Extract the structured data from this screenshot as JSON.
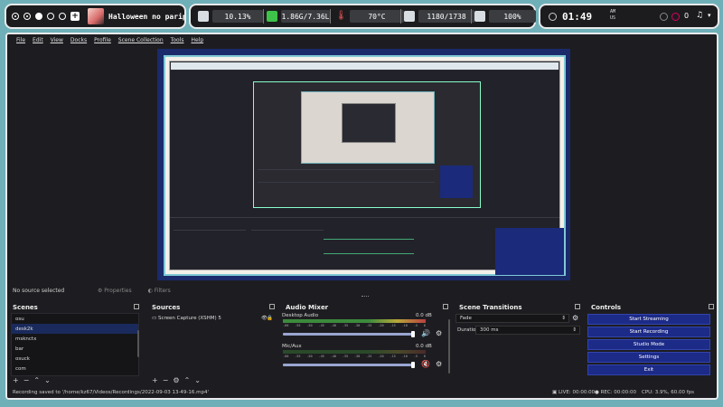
{
  "waybar": {
    "window_title": "Halloween no paripi",
    "cpu": "10.13%",
    "ram": "1.86G/7.36L",
    "temp": "70°C",
    "disk": "1180/1738",
    "battery": "100%",
    "time_hm": "01:49",
    "time_ampm_top": "AM",
    "time_ampm_bottom": "US",
    "notif_count": "0"
  },
  "menu": [
    "File",
    "Edit",
    "View",
    "Docks",
    "Profile",
    "Scene Collection",
    "Tools",
    "Help"
  ],
  "preview_toolbar": {
    "no_source": "No source selected",
    "properties": "Properties",
    "filters": "Filters"
  },
  "scenes": {
    "title": "Scenes",
    "items": [
      "osu",
      "desk2k",
      "msknctx",
      "bar",
      "osuck",
      "com"
    ],
    "selected_index": 1
  },
  "sources": {
    "title": "Sources",
    "items": [
      "Screen Capture (XSHM) 5"
    ]
  },
  "mixer": {
    "title": "Audio Mixer",
    "channels": [
      {
        "name": "Desktop Audio",
        "db": "0.0 dB"
      },
      {
        "name": "Mic/Aux",
        "db": "0.0 dB"
      }
    ],
    "ticks": [
      "-60",
      "-55",
      "-50",
      "-45",
      "-40",
      "-35",
      "-30",
      "-25",
      "-20",
      "-15",
      "-10",
      "-5",
      "0"
    ]
  },
  "transitions": {
    "title": "Scene Transitions",
    "selected": "Fade",
    "duration_label": "Duration",
    "duration_value": "300 ms"
  },
  "controls": {
    "title": "Controls",
    "buttons": [
      "Start Streaming",
      "Start Recording",
      "Studio Mode",
      "Settings",
      "Exit"
    ]
  },
  "status": {
    "left": "Recording saved to '/home/kz67/Videos/Recordings/2022-09-03 13-49-16.mp4'",
    "live": "LIVE: 00:00:00",
    "rec": "REC: 00:00:00",
    "cpu": "CPU: 3.9%, 60.00 fps"
  },
  "colors": {
    "accent_blue": "#1c2a88",
    "frame": "#e9e9ec",
    "bg": "#1d1d21"
  }
}
